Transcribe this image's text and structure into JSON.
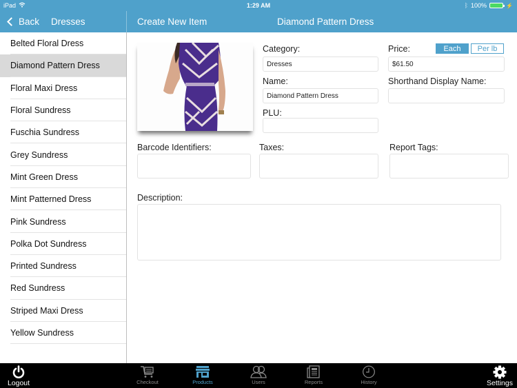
{
  "status_bar": {
    "device": "iPad",
    "time": "1:29 AM",
    "battery": "100%"
  },
  "nav": {
    "back_label": "Back",
    "list_title": "Dresses",
    "create_label": "Create New Item",
    "detail_title": "Diamond Pattern Dress"
  },
  "sidebar": {
    "items": [
      {
        "label": "Belted Floral Dress",
        "selected": false
      },
      {
        "label": "Diamond Pattern Dress",
        "selected": true
      },
      {
        "label": "Floral Maxi Dress",
        "selected": false
      },
      {
        "label": "Floral Sundress",
        "selected": false
      },
      {
        "label": "Fuschia Sundress",
        "selected": false
      },
      {
        "label": "Grey Sundress",
        "selected": false
      },
      {
        "label": "Mint Green Dress",
        "selected": false
      },
      {
        "label": "Mint Patterned Dress",
        "selected": false
      },
      {
        "label": "Pink Sundress",
        "selected": false
      },
      {
        "label": "Polka Dot Sundress",
        "selected": false
      },
      {
        "label": "Printed Sundress",
        "selected": false
      },
      {
        "label": "Red Sundress",
        "selected": false
      },
      {
        "label": "Striped Maxi Dress",
        "selected": false
      },
      {
        "label": "Yellow Sundress",
        "selected": false
      }
    ]
  },
  "form": {
    "category": {
      "label": "Category:",
      "value": "Dresses"
    },
    "price": {
      "label": "Price:",
      "value": "$61.50",
      "unit_options": [
        "Each",
        "Per lb"
      ],
      "unit_selected": "Each"
    },
    "name": {
      "label": "Name:",
      "value": "Diamond Pattern Dress"
    },
    "shorthand": {
      "label": "Shorthand Display Name:",
      "value": ""
    },
    "plu": {
      "label": "PLU:",
      "value": ""
    },
    "barcode": {
      "label": "Barcode Identifiers:",
      "value": ""
    },
    "taxes": {
      "label": "Taxes:",
      "value": ""
    },
    "report_tags": {
      "label": "Report Tags:",
      "value": ""
    },
    "description": {
      "label": "Description:",
      "value": ""
    }
  },
  "tabbar": {
    "logout": "Logout",
    "settings": "Settings",
    "tabs": [
      {
        "label": "Checkout",
        "icon": "cart-icon",
        "active": false
      },
      {
        "label": "Products",
        "icon": "store-icon",
        "active": true
      },
      {
        "label": "Users",
        "icon": "users-icon",
        "active": false
      },
      {
        "label": "Reports",
        "icon": "reports-icon",
        "active": false
      },
      {
        "label": "History",
        "icon": "clock-icon",
        "active": false
      }
    ]
  },
  "colors": {
    "accent": "#4fa1cb",
    "selected_row": "#d9d9d9",
    "tabbar": "#000000"
  }
}
